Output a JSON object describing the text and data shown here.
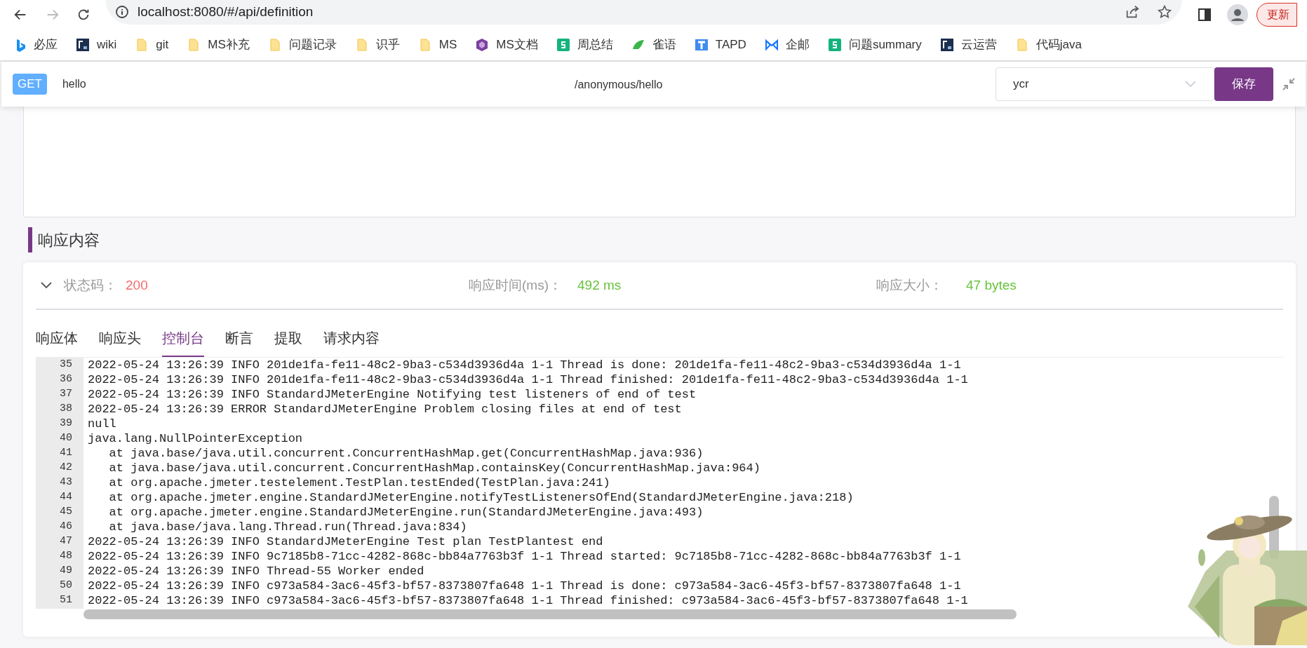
{
  "browser": {
    "url": "localhost:8080/#/api/definition",
    "forward_disabled": true,
    "update_label": "更新"
  },
  "bookmarks": [
    {
      "label": "必应",
      "kind": "bing"
    },
    {
      "label": "wiki",
      "kind": "f2c"
    },
    {
      "label": "git",
      "kind": "folder"
    },
    {
      "label": "MS补充",
      "kind": "folder"
    },
    {
      "label": "问题记录",
      "kind": "folder"
    },
    {
      "label": "识乎",
      "kind": "folder"
    },
    {
      "label": "MS",
      "kind": "folder"
    },
    {
      "label": "MS文档",
      "kind": "cube"
    },
    {
      "label": "周总结",
      "kind": "sheet"
    },
    {
      "label": "雀语",
      "kind": "bird"
    },
    {
      "label": "TAPD",
      "kind": "tapd"
    },
    {
      "label": "企邮",
      "kind": "mail"
    },
    {
      "label": "问题summary",
      "kind": "sheet"
    },
    {
      "label": "云运营",
      "kind": "f2c"
    },
    {
      "label": "代码java",
      "kind": "folder"
    }
  ],
  "request": {
    "method": "GET",
    "name": "hello",
    "path": "/anonymous/hello",
    "environment": "ycr",
    "save_label": "保存"
  },
  "response": {
    "title": "响应内容",
    "expanded": true,
    "status_label": "状态码：",
    "status": "200",
    "time_label": "响应时间(ms)：",
    "time": "492 ms",
    "size_label": "响应大小：",
    "size": "47 bytes",
    "tabs": [
      {
        "label": "响应体",
        "selected": false
      },
      {
        "label": "响应头",
        "selected": false
      },
      {
        "label": "控制台",
        "selected": true
      },
      {
        "label": "断言",
        "selected": false
      },
      {
        "label": "提取",
        "selected": false
      },
      {
        "label": "请求内容",
        "selected": false
      }
    ],
    "lines": [
      {
        "number": "35",
        "text": "2022-05-24 13:26:39 INFO 201de1fa-fe11-48c2-9ba3-c534d3936d4a 1-1 Thread is done: 201de1fa-fe11-48c2-9ba3-c534d3936d4a 1-1"
      },
      {
        "number": "36",
        "text": "2022-05-24 13:26:39 INFO 201de1fa-fe11-48c2-9ba3-c534d3936d4a 1-1 Thread finished: 201de1fa-fe11-48c2-9ba3-c534d3936d4a 1-1"
      },
      {
        "number": "37",
        "text": "2022-05-24 13:26:39 INFO StandardJMeterEngine Notifying test listeners of end of test"
      },
      {
        "number": "38",
        "text": "2022-05-24 13:26:39 ERROR StandardJMeterEngine Problem closing files at end of test"
      },
      {
        "number": "39",
        "text": "null"
      },
      {
        "number": "40",
        "text": "java.lang.NullPointerException"
      },
      {
        "number": "41",
        "text": "   at java.base/java.util.concurrent.ConcurrentHashMap.get(ConcurrentHashMap.java:936)"
      },
      {
        "number": "42",
        "text": "   at java.base/java.util.concurrent.ConcurrentHashMap.containsKey(ConcurrentHashMap.java:964)"
      },
      {
        "number": "43",
        "text": "   at org.apache.jmeter.testelement.TestPlan.testEnded(TestPlan.java:241)"
      },
      {
        "number": "44",
        "text": "   at org.apache.jmeter.engine.StandardJMeterEngine.notifyTestListenersOfEnd(StandardJMeterEngine.java:218)"
      },
      {
        "number": "45",
        "text": "   at org.apache.jmeter.engine.StandardJMeterEngine.run(StandardJMeterEngine.java:493)"
      },
      {
        "number": "46",
        "text": "   at java.base/java.lang.Thread.run(Thread.java:834)"
      },
      {
        "number": "47",
        "text": "2022-05-24 13:26:39 INFO StandardJMeterEngine Test plan TestPlantest end"
      },
      {
        "number": "48",
        "text": "2022-05-24 13:26:39 INFO 9c7185b8-71cc-4282-868c-bb84a7763b3f 1-1 Thread started: 9c7185b8-71cc-4282-868c-bb84a7763b3f 1-1"
      },
      {
        "number": "49",
        "text": "2022-05-24 13:26:39 INFO Thread-55 Worker ended"
      },
      {
        "number": "50",
        "text": "2022-05-24 13:26:39 INFO c973a584-3ac6-45f3-bf57-8373807fa648 1-1 Thread is done: c973a584-3ac6-45f3-bf57-8373807fa648 1-1"
      },
      {
        "number": "51",
        "text": "2022-05-24 13:26:39 INFO c973a584-3ac6-45f3-bf57-8373807fa648 1-1 Thread finished: c973a584-3ac6-45f3-bf57-8373807fa648 1-1"
      }
    ]
  }
}
